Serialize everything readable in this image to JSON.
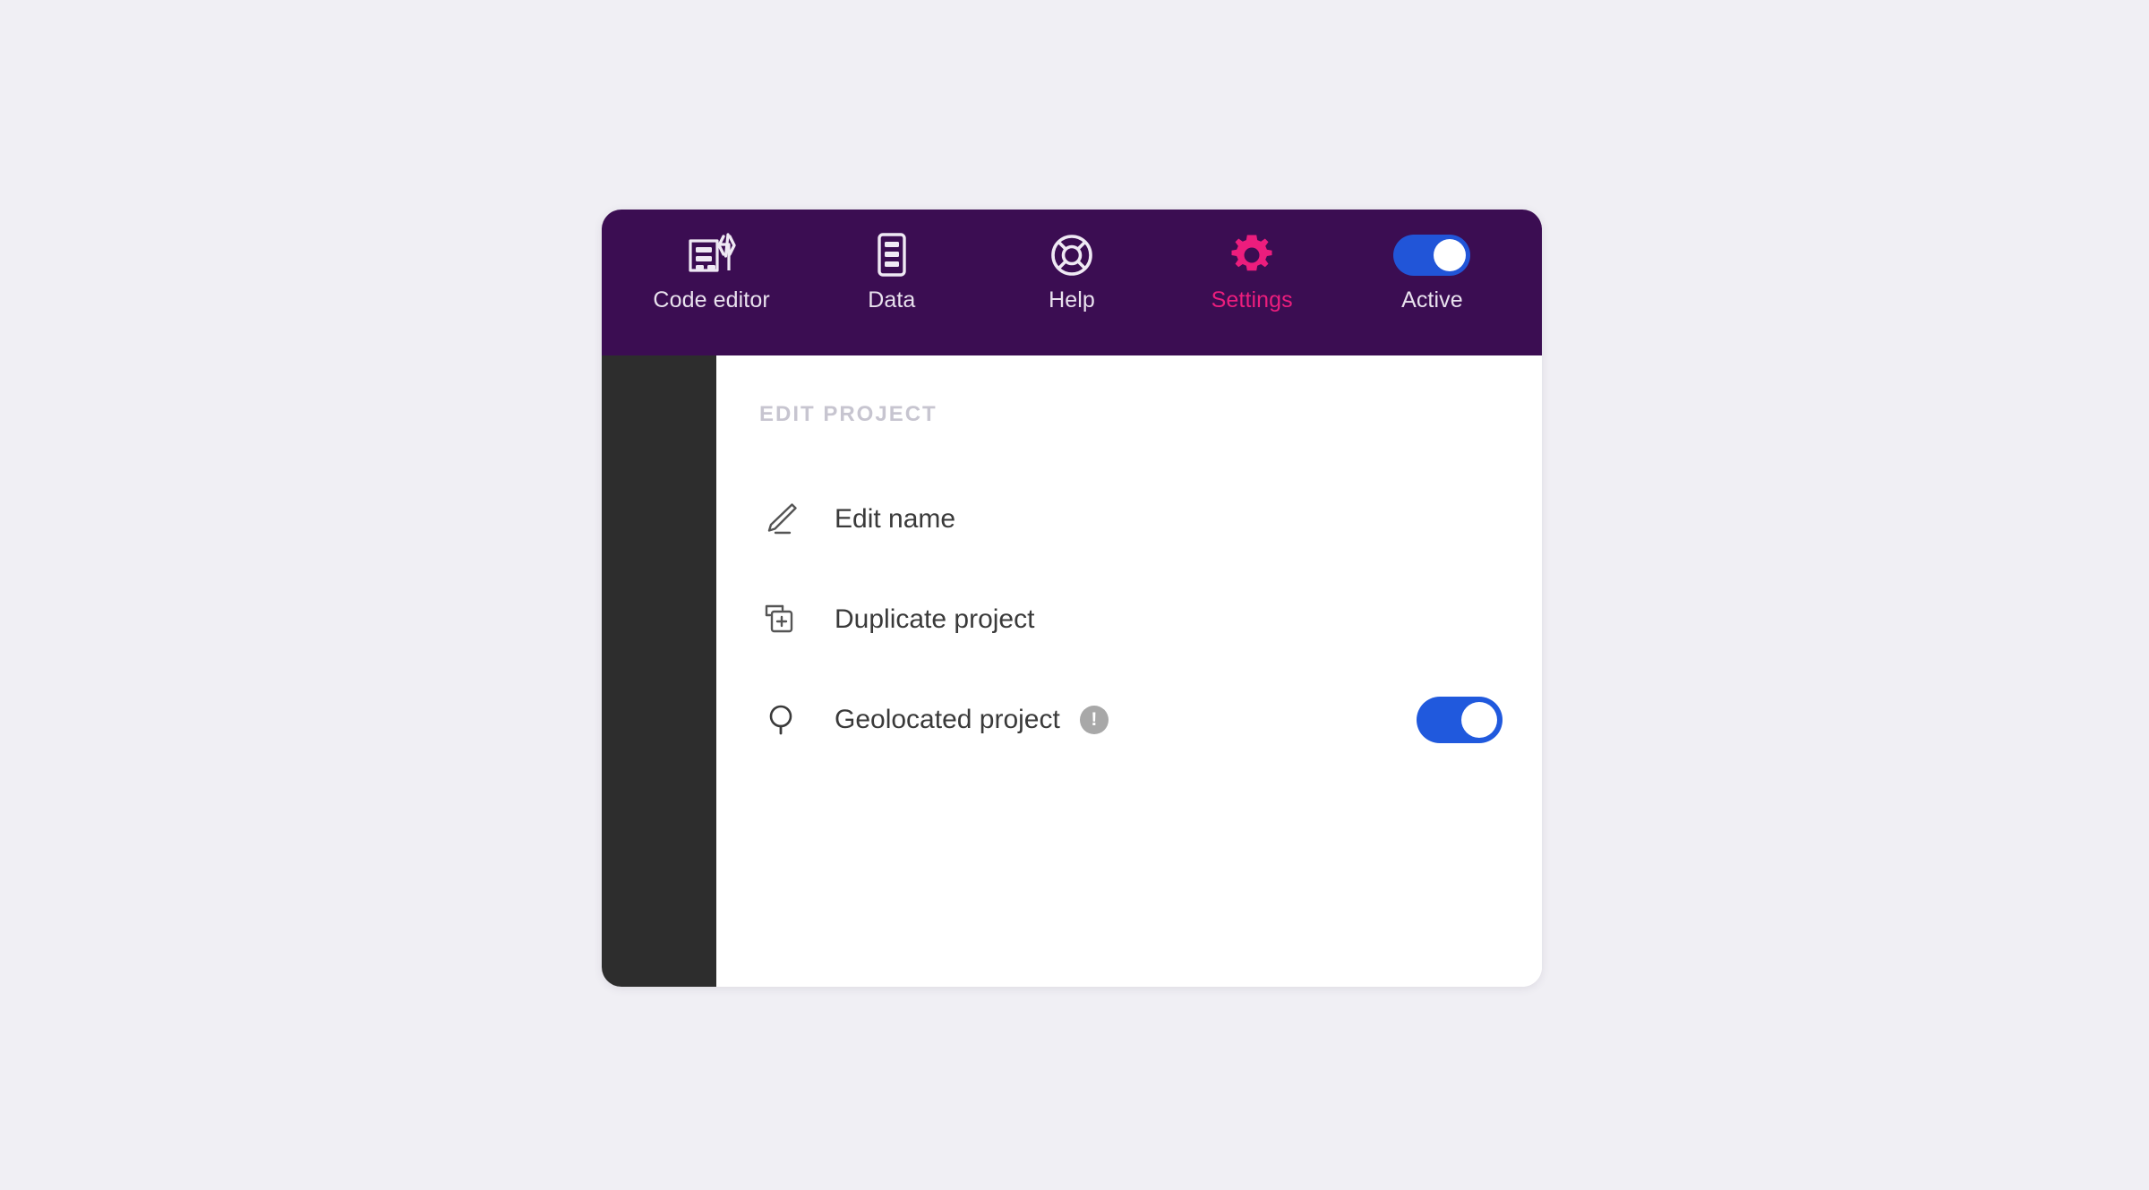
{
  "window": {
    "background_color": "#f0eff4",
    "header_color": "#3b0d52",
    "accent_color": "#ec1d7d",
    "toggle_on_color": "#2155d8",
    "sidebar_color": "#2d2d2d"
  },
  "top_nav": {
    "items": [
      {
        "label": "Code editor",
        "icon": "code-editor-icon",
        "active": false
      },
      {
        "label": "Data",
        "icon": "data-list-icon",
        "active": false
      },
      {
        "label": "Help",
        "icon": "lifebuoy-help-icon",
        "active": false
      },
      {
        "label": "Settings",
        "icon": "gear-icon",
        "active": true
      },
      {
        "label": "Active",
        "icon": "toggle-switch-icon",
        "active": false,
        "toggle_state": "on"
      }
    ]
  },
  "content": {
    "section_title": "EDIT PROJECT",
    "rows": [
      {
        "label": "Edit name",
        "icon": "pencil-icon",
        "badge": null,
        "toggle": null
      },
      {
        "label": "Duplicate project",
        "icon": "copy-plus-icon",
        "badge": null,
        "toggle": null
      },
      {
        "label": "Geolocated project",
        "icon": "location-pin-icon",
        "badge": "!",
        "toggle": "on"
      }
    ]
  }
}
